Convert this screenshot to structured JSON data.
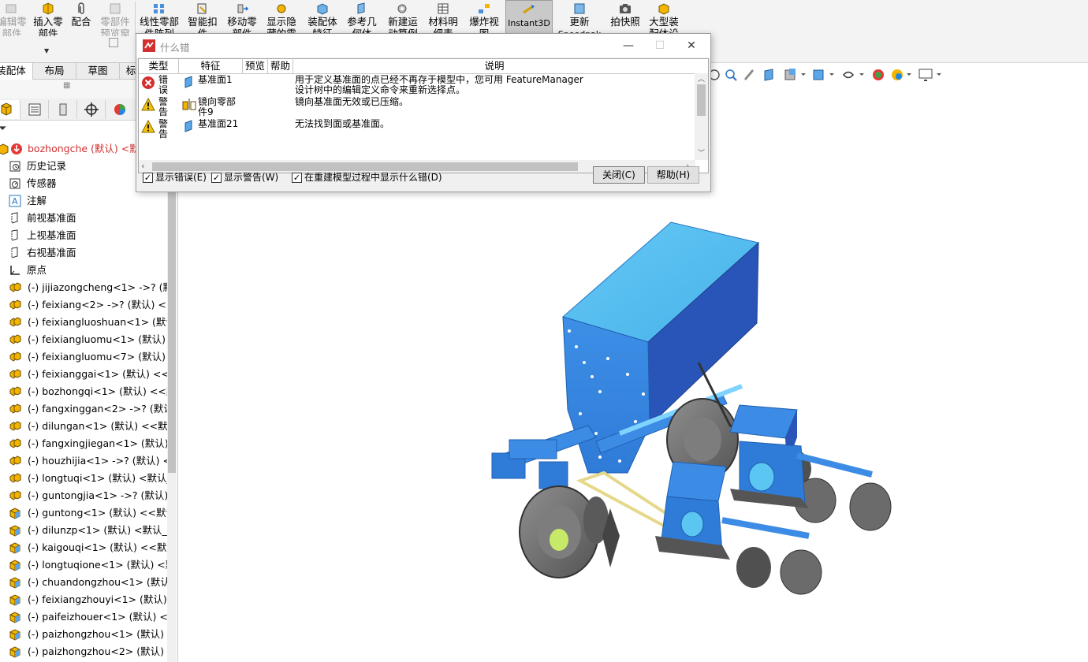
{
  "ribbon": {
    "buttons": [
      {
        "label1": "编辑零",
        "label2": "部件",
        "disabled": true
      },
      {
        "label1": "插入零",
        "label2": "部件"
      },
      {
        "label1": "配合",
        "label2": ""
      },
      {
        "label1": "零部件",
        "label2": "预览窗",
        "disabled": true
      },
      {
        "label1": "线性零部",
        "label2": "件阵列"
      },
      {
        "label1": "智能扣",
        "label2": "件"
      },
      {
        "label1": "移动零",
        "label2": "部件"
      },
      {
        "label1": "显示隐",
        "label2": "藏的零"
      },
      {
        "label1": "装配体",
        "label2": "特征"
      },
      {
        "label1": "参考几",
        "label2": "何体"
      },
      {
        "label1": "新建运",
        "label2": "动算例"
      },
      {
        "label1": "材料明",
        "label2": "细表"
      },
      {
        "label1": "爆炸视",
        "label2": "图"
      },
      {
        "label1": "Instant3D",
        "label2": "",
        "active": true
      },
      {
        "label1": "更新",
        "label2": "Speedpak"
      },
      {
        "label1": "拍快照",
        "label2": ""
      },
      {
        "label1": "大型装",
        "label2": "配体设"
      }
    ]
  },
  "tabs": [
    "装配体",
    "布局",
    "草图",
    "标"
  ],
  "tree": {
    "root": "bozhongche (默认) <默认",
    "items": [
      {
        "label": "历史记录",
        "icon": "history-icon"
      },
      {
        "label": "传感器",
        "icon": "sensor-icon"
      },
      {
        "label": "注解",
        "icon": "annotation-icon"
      },
      {
        "label": "前视基准面",
        "icon": "plane-icon"
      },
      {
        "label": "上视基准面",
        "icon": "plane-icon"
      },
      {
        "label": "右视基准面",
        "icon": "plane-icon"
      },
      {
        "label": "原点",
        "icon": "origin-icon"
      },
      {
        "label": "(-) jijiazongcheng<1> ->? (默认",
        "icon": "assembly-icon"
      },
      {
        "label": "(-) feixiang<2> ->? (默认) <<默",
        "icon": "assembly-icon"
      },
      {
        "label": "(-) feixiangluoshuan<1> (默认)",
        "icon": "assembly-icon"
      },
      {
        "label": "(-) feixiangluomu<1> (默认) <",
        "icon": "assembly-icon"
      },
      {
        "label": "(-) feixiangluomu<7> (默认) <",
        "icon": "assembly-icon"
      },
      {
        "label": "(-) feixianggai<1> (默认) <<默",
        "icon": "assembly-icon"
      },
      {
        "label": "(-) bozhongqi<1> (默认) <<默",
        "icon": "assembly-icon"
      },
      {
        "label": "(-) fangxinggan<2> ->? (默认)",
        "icon": "assembly-icon"
      },
      {
        "label": "(-) dilungan<1> (默认) <<默认",
        "icon": "assembly-icon"
      },
      {
        "label": "(-) fangxingjiegan<1> (默认) <",
        "icon": "assembly-icon"
      },
      {
        "label": "(-) houzhijia<1> ->? (默认) <<",
        "icon": "assembly-icon"
      },
      {
        "label": "(-) longtuqi<1> (默认) <默认_显",
        "icon": "assembly-icon"
      },
      {
        "label": "(-) guntongjia<1> ->? (默认) <",
        "icon": "assembly-icon"
      },
      {
        "label": "(-) guntong<1> (默认) <<默认",
        "icon": "part-icon"
      },
      {
        "label": "(-) dilunzp<1> (默认) <默认_显",
        "icon": "part-icon"
      },
      {
        "label": "(-) kaigouqi<1> (默认) <<默认",
        "icon": "part-icon"
      },
      {
        "label": "(-) longtuqione<1> (默认) <默",
        "icon": "part-icon"
      },
      {
        "label": "(-) chuandongzhou<1> (默认) <",
        "icon": "part-icon"
      },
      {
        "label": "(-) feixiangzhouyi<1> (默认) <",
        "icon": "part-icon"
      },
      {
        "label": "(-) paifeizhouer<1> (默认) <默",
        "icon": "part-icon"
      },
      {
        "label": "(-) paizhongzhou<1> (默认) <",
        "icon": "part-icon"
      },
      {
        "label": "(-) paizhongzhou<2> (默认) <",
        "icon": "part-icon"
      }
    ]
  },
  "dialog": {
    "title": "什么错",
    "columns": [
      "类型",
      "特征",
      "预览",
      "帮助",
      "说明"
    ],
    "rows": [
      {
        "type": "错误",
        "type_icon": "error-icon",
        "feature": "基准面1",
        "feature_icon": "plane-feature-icon",
        "desc1": "用于定义基准面的点已经不再存于模型中，您可用 FeatureManager",
        "desc2": "设计树中的编辑定义命令来重新选择点。"
      },
      {
        "type": "警告",
        "type_icon": "warning-icon",
        "feature": "镜向零部件9",
        "feature_icon": "mirror-component-icon",
        "desc1": "镜向基准面无效或已压缩。",
        "desc2": ""
      },
      {
        "type": "警告",
        "type_icon": "warning-icon",
        "feature": "基准面21",
        "feature_icon": "plane-feature-icon",
        "desc1": "无法找到面或基准面。",
        "desc2": ""
      }
    ],
    "checkboxes": [
      {
        "label": "显示错误(E)",
        "checked": true
      },
      {
        "label": "显示警告(W)",
        "checked": true
      },
      {
        "label": "在重建模型过程中显示什么错(D)",
        "checked": true
      }
    ],
    "close_label": "关闭(C)",
    "help_label": "帮助(H)"
  },
  "colors": {
    "accent": "#1e88e5",
    "model_blue": "#2e8be8",
    "model_light": "#5cc6f2",
    "error": "#d32f2f",
    "warning": "#f4c20d"
  }
}
